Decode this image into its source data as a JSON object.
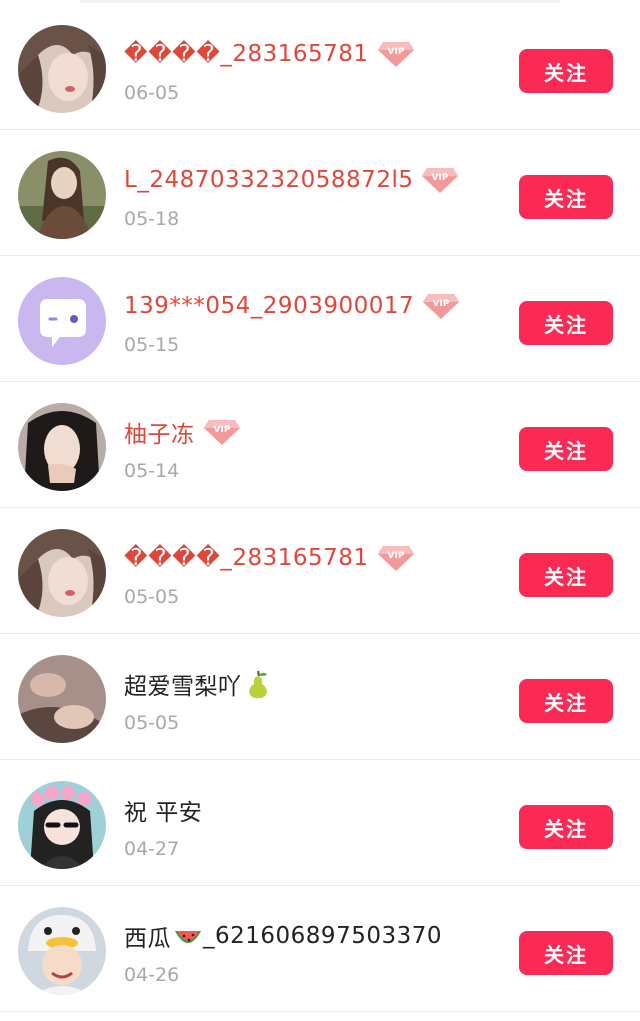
{
  "follow_list": {
    "items": [
      {
        "name": "����_283165781",
        "vip": true,
        "date": "06-05",
        "follow_label": "关注",
        "avatar": "girl-hair-avatar"
      },
      {
        "name": "L_2487033232058872l5",
        "vip": true,
        "date": "05-18",
        "follow_label": "关注",
        "avatar": "girl-outdoor-avatar"
      },
      {
        "name": "139***054_2903900017",
        "vip": true,
        "date": "05-15",
        "follow_label": "关注",
        "avatar": "chat-bubble-avatar"
      },
      {
        "name": "柚子冻",
        "vip": true,
        "date": "05-14",
        "follow_label": "关注",
        "avatar": "girl-hand-avatar"
      },
      {
        "name": "����_283165781",
        "vip": true,
        "date": "05-05",
        "follow_label": "关注",
        "avatar": "girl-hair-avatar"
      },
      {
        "name": "超爱雪梨吖",
        "vip": false,
        "emoji": "pear-icon",
        "date": "05-05",
        "follow_label": "关注",
        "avatar": "couple-avatar"
      },
      {
        "name": "祝 平安",
        "vip": false,
        "date": "04-27",
        "follow_label": "关注",
        "avatar": "cartoon-girl-avatar"
      },
      {
        "name_prefix": "西瓜",
        "emoji": "watermelon-icon",
        "name_suffix": "_621606897503370",
        "vip": false,
        "date": "04-26",
        "follow_label": "关注",
        "avatar": "kid-duck-hat-avatar"
      }
    ]
  },
  "colors": {
    "follow_button": "#fa2a55",
    "vip_name": "#e0473a",
    "date": "#a8a8a8"
  }
}
